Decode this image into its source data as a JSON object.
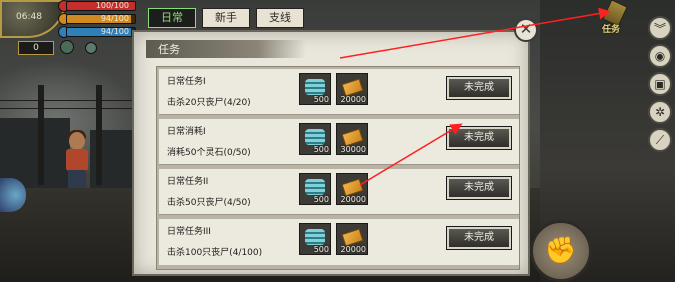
{
  "hud": {
    "time": "06:48",
    "hp": "100/100",
    "hp_ratio": 1.0,
    "food": "94/100",
    "food_ratio": 0.94,
    "water": "94/100",
    "water_ratio": 0.94,
    "level": "0"
  },
  "tabs": [
    {
      "label": "日常",
      "active": true
    },
    {
      "label": "新手",
      "active": false
    },
    {
      "label": "支线",
      "active": false
    }
  ],
  "panel": {
    "title": "任务",
    "close_symbol": "✕"
  },
  "quests": [
    {
      "name": "日常任务I",
      "desc": "击杀20只丧尸(4/20)",
      "coin_qty": "500",
      "ticket_qty": "20000",
      "status": "未完成"
    },
    {
      "name": "日常消耗I",
      "desc": "消耗50个灵石(0/50)",
      "coin_qty": "500",
      "ticket_qty": "30000",
      "status": "未完成"
    },
    {
      "name": "日常任务II",
      "desc": "击杀50只丧尸(4/50)",
      "coin_qty": "500",
      "ticket_qty": "20000",
      "status": "未完成"
    },
    {
      "name": "日常任务III",
      "desc": "击杀100只丧尸(4/100)",
      "coin_qty": "500",
      "ticket_qty": "20000",
      "status": "未完成"
    }
  ],
  "side_menu": {
    "quest_label": "任务"
  },
  "colors": {
    "active_tab_text": "#8ddc7a",
    "annotation_arrow": "#ff2020"
  }
}
